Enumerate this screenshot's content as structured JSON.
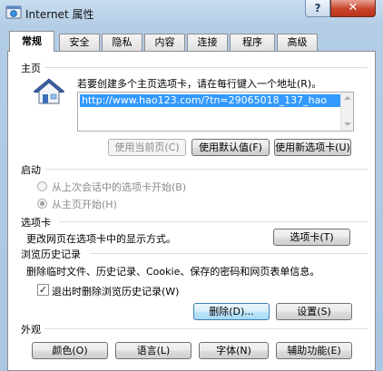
{
  "window": {
    "title": "Internet 属性",
    "help": "?",
    "close": "✕"
  },
  "tabs": [
    "常规",
    "安全",
    "隐私",
    "内容",
    "连接",
    "程序",
    "高级"
  ],
  "home": {
    "group": "主页",
    "instruction": "若要创建多个主页选项卡，请在每行键入一个地址(R)。",
    "url": "http://www.hao123.com/?tn=29065018_137_hao",
    "use_current": "使用当前页(C)",
    "use_default": "使用默认值(F)",
    "use_new_tab": "使用新选项卡(U)"
  },
  "startup": {
    "group": "启动",
    "option_last_session": "从上次会话中的选项卡开始(B)",
    "option_home": "从主页开始(H)"
  },
  "tabs_section": {
    "group": "选项卡",
    "description": "更改网页在选项卡中的显示方式。",
    "button": "选项卡(T)"
  },
  "history": {
    "group": "浏览历史记录",
    "description": "删除临时文件、历史记录、Cookie、保存的密码和网页表单信息。",
    "checkbox_label": "退出时删除浏览历史记录(W)",
    "checkbox_mark": "✓",
    "delete": "删除(D)...",
    "settings": "设置(S)"
  },
  "appearance": {
    "group": "外观",
    "colors": "颜色(O)",
    "languages": "语言(L)",
    "fonts": "字体(N)",
    "accessibility": "辅助功能(E)"
  }
}
